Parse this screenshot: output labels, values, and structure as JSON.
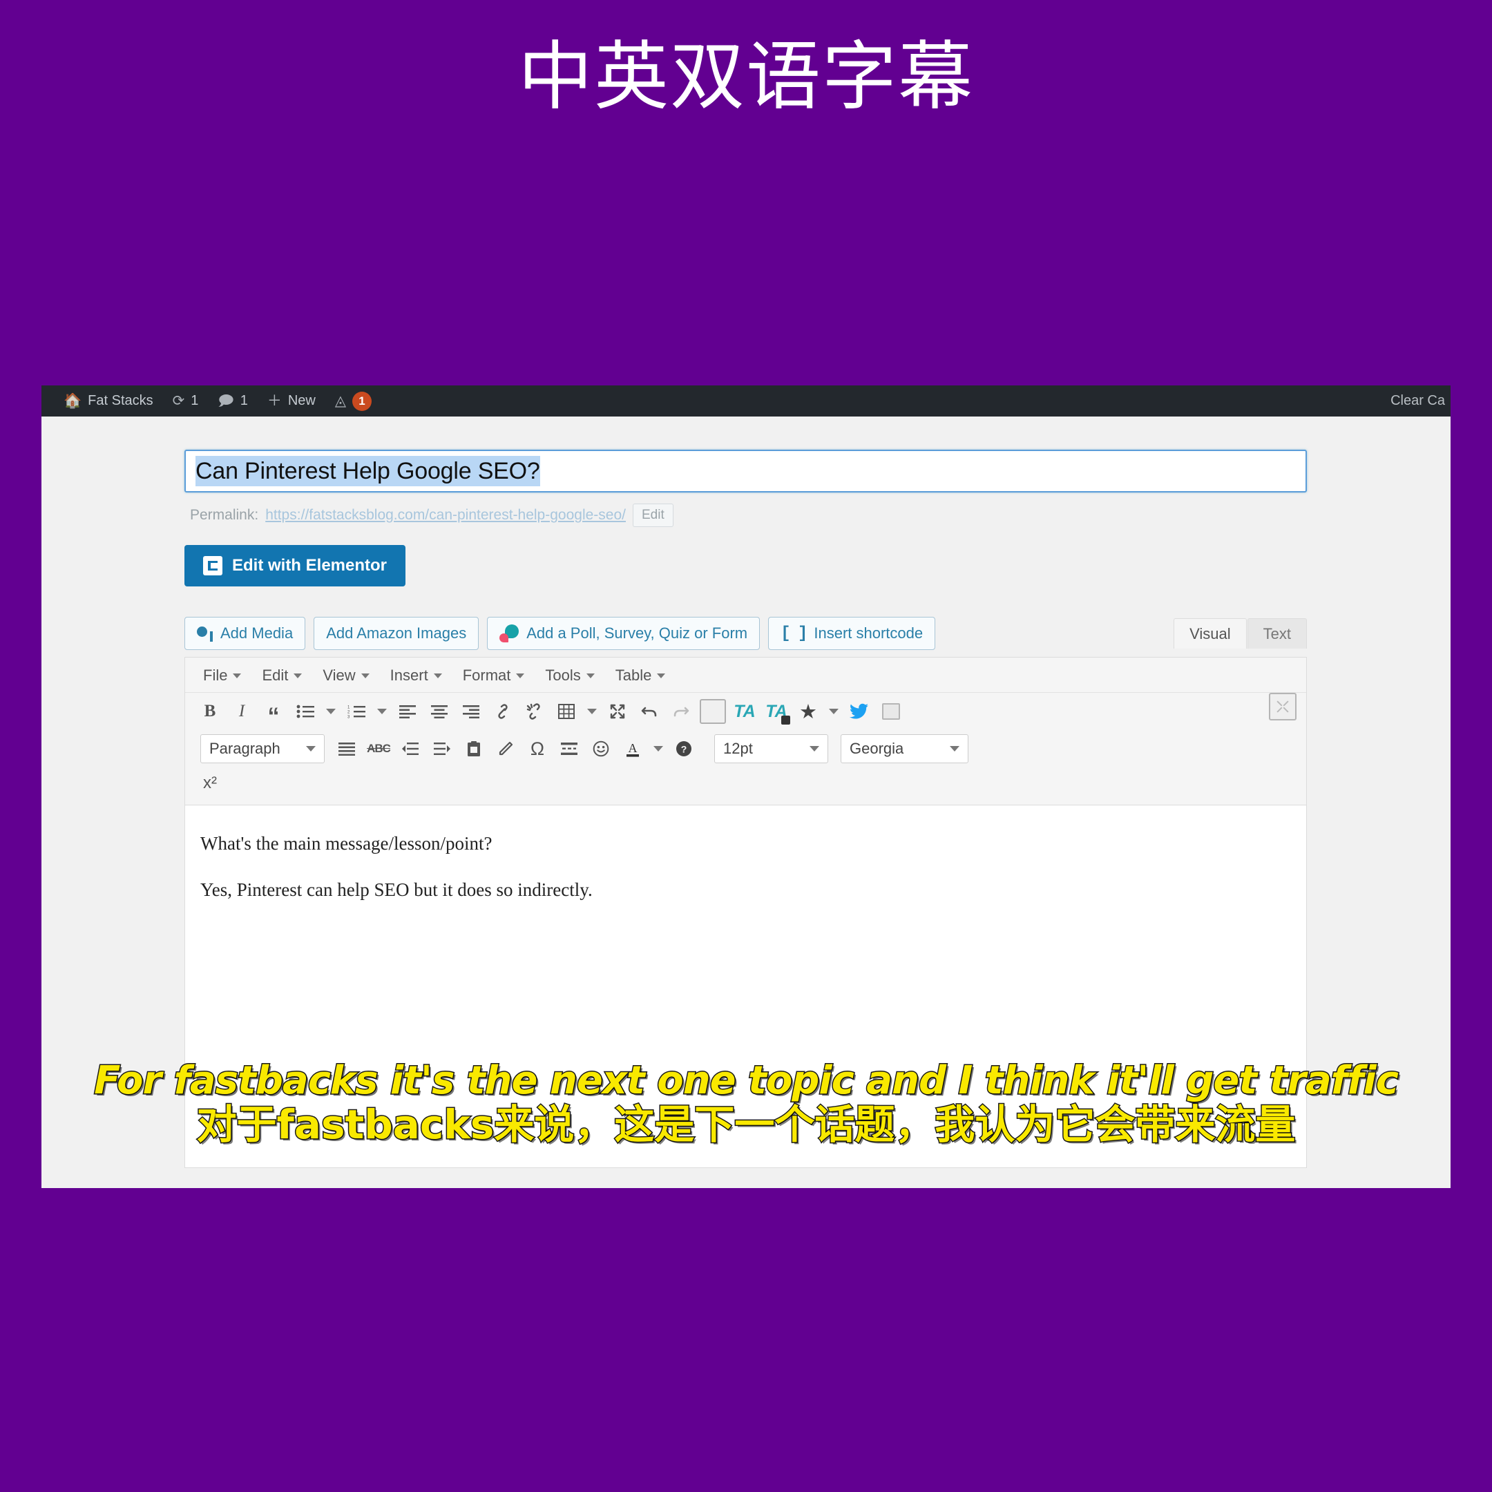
{
  "banner": {
    "title": "中英双语字幕"
  },
  "colors": {
    "background": "#620091",
    "admin_bar": "#23282d",
    "elementor_blue": "#1275b0",
    "subtitle_yellow": "#f9e900",
    "selection_blue": "#b9d7f5"
  },
  "admin_bar": {
    "home_icon": "wordpress-home-icon",
    "site_name": "Fat Stacks",
    "updates_icon": "updates-icon",
    "updates_count": "1",
    "comments_icon": "comments-icon",
    "comments_count": "1",
    "new_icon": "plus-icon",
    "new_label": "New",
    "plugin_icon": "yoast-icon",
    "notification_count": "1",
    "right_label": "Clear Ca"
  },
  "post": {
    "title_value": "Can Pinterest Help Google SEO?",
    "permalink_label": "Permalink:",
    "permalink_url": "https://fatstacksblog.com/can-pinterest-help-google-seo/",
    "permalink_edit": "Edit",
    "elementor_button": "Edit with Elementor"
  },
  "media_buttons": [
    {
      "label": "Add Media",
      "icon": "add-media-icon"
    },
    {
      "label": "Add Amazon Images",
      "icon": "none"
    },
    {
      "label": "Add a Poll, Survey, Quiz or Form",
      "icon": "poll-icon"
    },
    {
      "label": "Insert shortcode",
      "icon": "shortcode-brackets-icon"
    }
  ],
  "editor_tabs": [
    {
      "label": "Visual",
      "active": true
    },
    {
      "label": "Text",
      "active": false
    }
  ],
  "menubar": [
    {
      "label": "File"
    },
    {
      "label": "Edit"
    },
    {
      "label": "View"
    },
    {
      "label": "Insert"
    },
    {
      "label": "Format"
    },
    {
      "label": "Tools"
    },
    {
      "label": "Table"
    }
  ],
  "toolbar_row1": [
    {
      "name": "bold-icon",
      "glyph": "B"
    },
    {
      "name": "italic-icon",
      "glyph": "I"
    },
    {
      "name": "blockquote-icon",
      "glyph": "“"
    },
    {
      "name": "bullet-list-icon",
      "glyph": "list"
    },
    {
      "name": "bullet-list-caret-icon",
      "glyph": "caret"
    },
    {
      "name": "numbered-list-icon",
      "glyph": "numlist"
    },
    {
      "name": "numbered-list-caret-icon",
      "glyph": "caret"
    },
    {
      "name": "align-left-icon",
      "glyph": "alignleft"
    },
    {
      "name": "align-center-icon",
      "glyph": "aligncenter"
    },
    {
      "name": "align-right-icon",
      "glyph": "alignright"
    },
    {
      "name": "link-icon",
      "glyph": "link"
    },
    {
      "name": "unlink-icon",
      "glyph": "unlink"
    },
    {
      "name": "table-icon",
      "glyph": "table"
    },
    {
      "name": "table-caret-icon",
      "glyph": "caret"
    },
    {
      "name": "fullscreen-icon",
      "glyph": "fullscreen"
    },
    {
      "name": "undo-icon",
      "glyph": "undo"
    },
    {
      "name": "redo-icon",
      "glyph": "redo"
    },
    {
      "name": "screen-box-icon",
      "glyph": "box"
    },
    {
      "name": "thrive-ta-icon",
      "glyph": "TA"
    },
    {
      "name": "thrive-ta-lock-icon",
      "glyph": "TA"
    },
    {
      "name": "star-icon",
      "glyph": "star"
    },
    {
      "name": "star-caret-icon",
      "glyph": "caret"
    },
    {
      "name": "twitter-icon",
      "glyph": "twitter"
    },
    {
      "name": "media-thumb-icon",
      "glyph": "thumb"
    }
  ],
  "toolbar_row2": {
    "paragraph_select": "Paragraph",
    "items": [
      {
        "name": "justify-icon"
      },
      {
        "name": "strikethrough-icon",
        "glyph": "ABC"
      },
      {
        "name": "outdent-icon"
      },
      {
        "name": "indent-icon"
      },
      {
        "name": "paste-icon"
      },
      {
        "name": "eraser-icon"
      },
      {
        "name": "special-character-icon",
        "glyph": "Ω"
      },
      {
        "name": "page-break-icon"
      },
      {
        "name": "emoji-icon"
      },
      {
        "name": "text-color-icon",
        "glyph": "A"
      },
      {
        "name": "text-color-caret-icon",
        "glyph": "caret"
      },
      {
        "name": "help-icon",
        "glyph": "?"
      }
    ],
    "font_size_select": "12pt",
    "font_family_select": "Georgia"
  },
  "toolbar_row3": [
    {
      "name": "superscript-icon",
      "glyph": "x²"
    }
  ],
  "editor_content": {
    "paragraphs": [
      "What's the main message/lesson/point?",
      "Yes, Pinterest can help SEO but it does so indirectly."
    ]
  },
  "subtitles": {
    "english": "For fastbacks it's the next one topic and I think it'll get traffic",
    "chinese": "对于fastbacks来说，这是下一个话题，我认为它会带来流量"
  }
}
